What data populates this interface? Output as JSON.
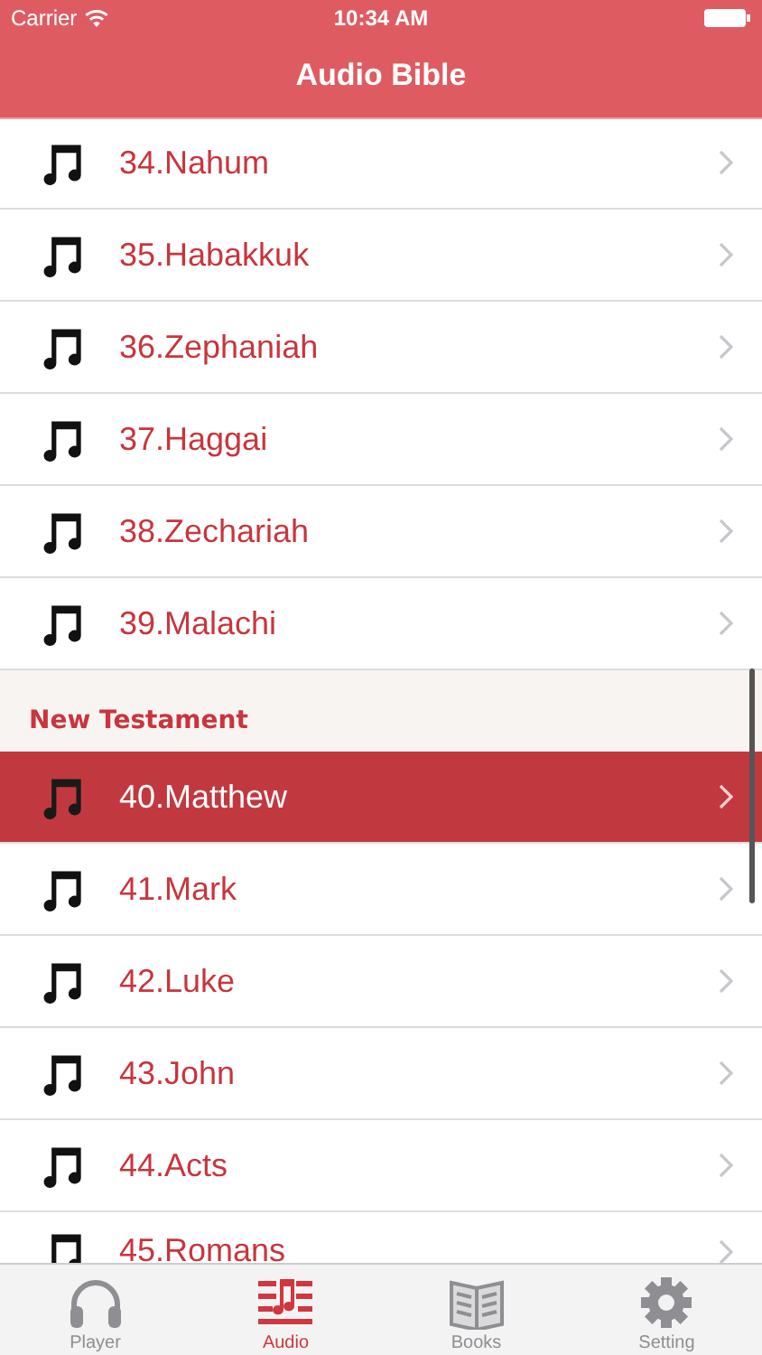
{
  "status_bar": {
    "carrier": "Carrier",
    "time": "10:34 AM"
  },
  "nav_bar": {
    "title": "Audio Bible"
  },
  "sections": [
    {
      "rows": [
        {
          "label": "34.Nahum",
          "selected": false
        },
        {
          "label": "35.Habakkuk",
          "selected": false
        },
        {
          "label": "36.Zephaniah",
          "selected": false
        },
        {
          "label": "37.Haggai",
          "selected": false
        },
        {
          "label": "38.Zechariah",
          "selected": false
        },
        {
          "label": "39.Malachi",
          "selected": false
        }
      ]
    },
    {
      "header": "New Testament",
      "rows": [
        {
          "label": "40.Matthew",
          "selected": true
        },
        {
          "label": "41.Mark",
          "selected": false
        },
        {
          "label": "42.Luke",
          "selected": false
        },
        {
          "label": "43.John",
          "selected": false
        },
        {
          "label": "44.Acts",
          "selected": false
        },
        {
          "label": "45.Romans",
          "selected": false
        }
      ]
    }
  ],
  "tab_bar": [
    {
      "label": "Player",
      "selected": false
    },
    {
      "label": "Audio",
      "selected": true
    },
    {
      "label": "Books",
      "selected": false
    },
    {
      "label": "Setting",
      "selected": false
    }
  ]
}
